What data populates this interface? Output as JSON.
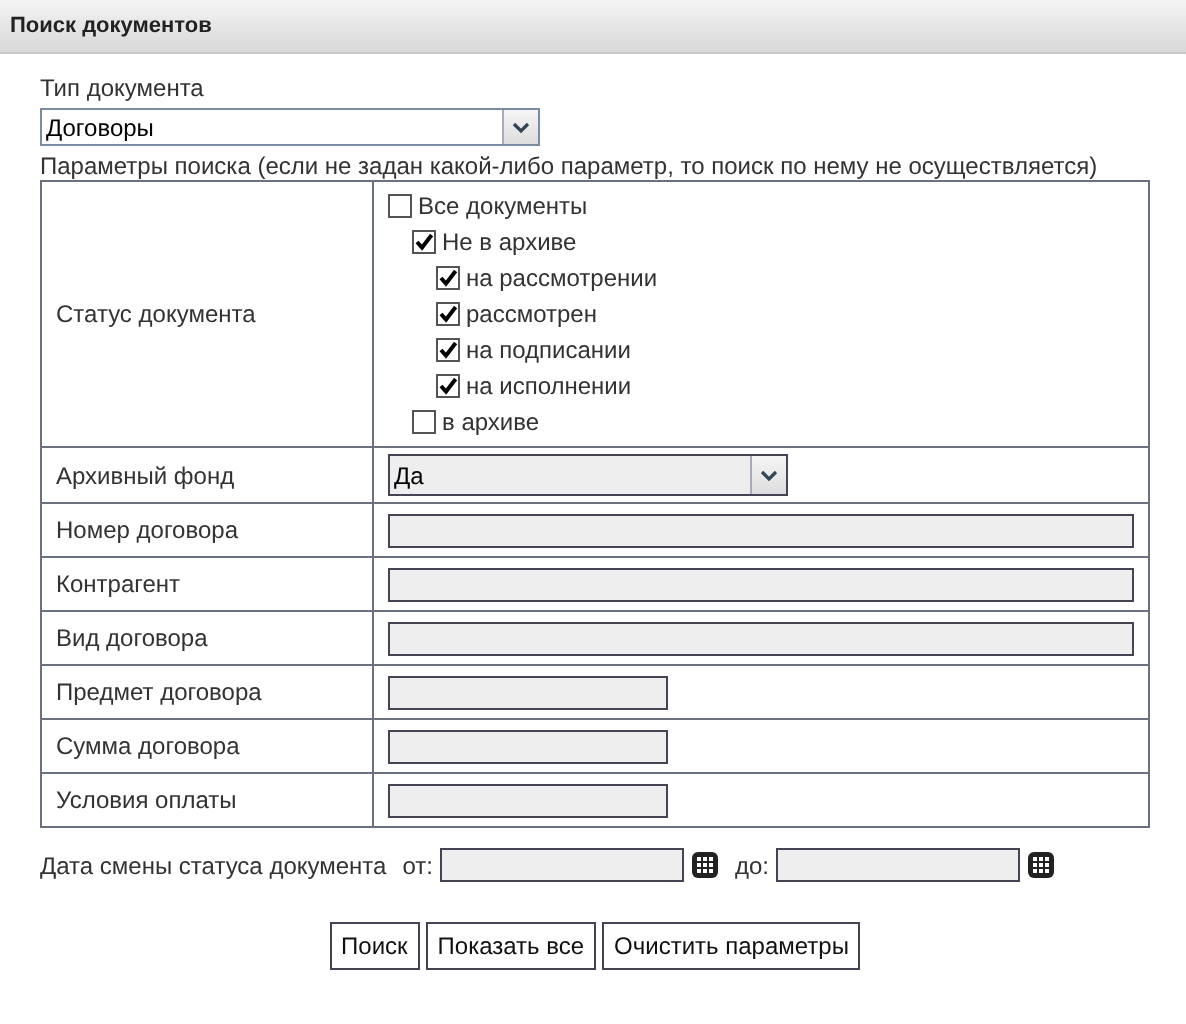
{
  "header": {
    "title": "Поиск документов"
  },
  "doc_type": {
    "label": "Тип документа",
    "value": "Договоры"
  },
  "hint": "Параметры поиска (если не задан какой-либо параметр, то поиск по нему не осуществляется)",
  "params": [
    {
      "kind": "checks",
      "label": "Статус документа",
      "items": [
        {
          "label": "Все документы",
          "checked": false
        },
        {
          "label": "Не в архиве",
          "checked": true,
          "children": [
            {
              "label": "на рассмотрении",
              "checked": true
            },
            {
              "label": "рассмотрен",
              "checked": true
            },
            {
              "label": "на подписании",
              "checked": true
            },
            {
              "label": "на исполнении",
              "checked": true
            }
          ]
        },
        {
          "label": "в архиве",
          "checked": false
        }
      ]
    },
    {
      "kind": "select",
      "label": "Архивный фонд",
      "value": "Да"
    },
    {
      "kind": "input_long",
      "label": "Номер договора"
    },
    {
      "kind": "input_long",
      "label": "Контрагент"
    },
    {
      "kind": "input_long",
      "label": "Вид договора"
    },
    {
      "kind": "input_short",
      "label": "Предмет договора"
    },
    {
      "kind": "input_short",
      "label": "Сумма договора"
    },
    {
      "kind": "input_short",
      "label": "Условия оплаты"
    }
  ],
  "date_filter": {
    "label": "Дата смены статуса документа",
    "from_label": "от:",
    "to_label": "до:"
  },
  "buttons": [
    "Поиск",
    "Показать все",
    "Очистить параметры"
  ]
}
